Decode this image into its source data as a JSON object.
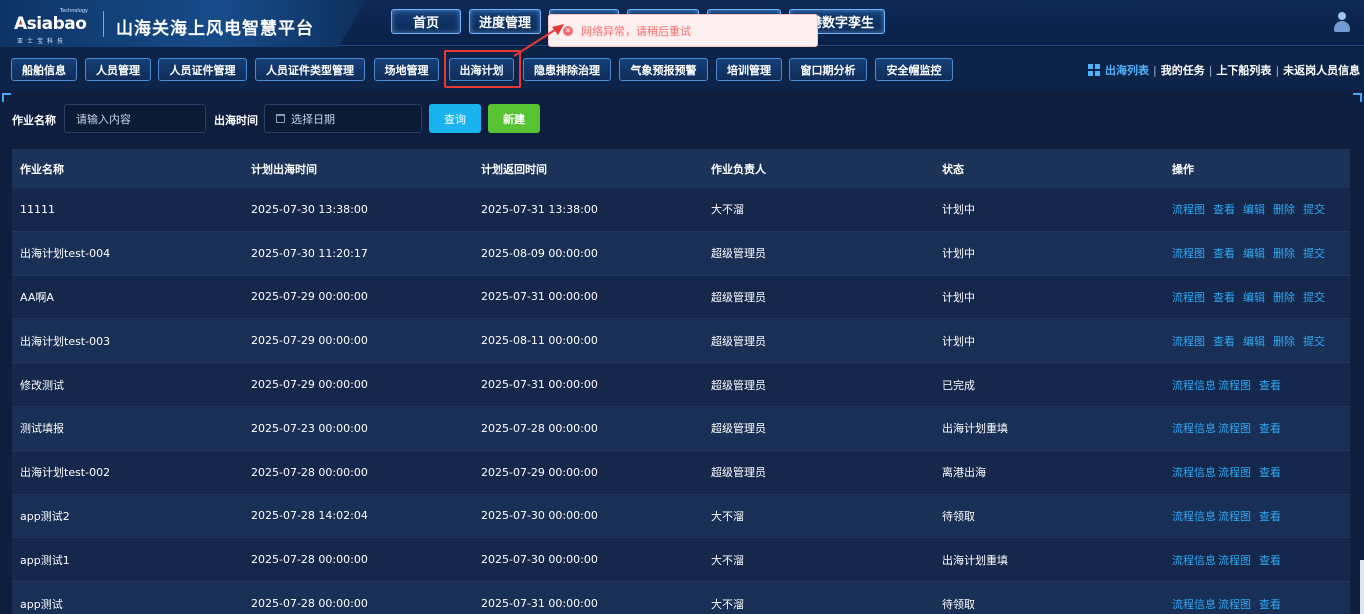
{
  "brand": {
    "logo_text": "Asiabao",
    "logo_tagline": "Technology",
    "logo_sub": "亚士宝科技",
    "app_title": "山海关海上风电智慧平台"
  },
  "top_nav": [
    {
      "label": "首页"
    },
    {
      "label": "进度管理"
    },
    {
      "label": ""
    },
    {
      "label": ""
    },
    {
      "label": ""
    },
    {
      "label": "港数字孪生"
    }
  ],
  "toast": {
    "message": "网络异常，请稍后重试",
    "color": "#f56c6c"
  },
  "sub_tabs": [
    {
      "label": "船舶信息"
    },
    {
      "label": "人员管理"
    },
    {
      "label": "人员证件管理"
    },
    {
      "label": "人员证件类型管理"
    },
    {
      "label": "场地管理"
    },
    {
      "label": "出海计划",
      "active": true
    },
    {
      "label": "隐患排除治理"
    },
    {
      "label": "气象预报预警"
    },
    {
      "label": "培训管理"
    },
    {
      "label": "窗口期分析"
    },
    {
      "label": "安全帽监控"
    }
  ],
  "right_links": [
    {
      "label": "出海列表",
      "active": true
    },
    {
      "label": "我的任务"
    },
    {
      "label": "上下船列表"
    },
    {
      "label": "未返岗人员信息"
    }
  ],
  "filters": {
    "job_name_label": "作业名称",
    "job_name_placeholder": "请输入内容",
    "date_label": "出海时间",
    "date_placeholder": "选择日期",
    "query_label": "查询",
    "create_label": "新建"
  },
  "table": {
    "headers": [
      "作业名称",
      "计划出海时间",
      "计划返回时间",
      "作业负责人",
      "状态",
      "操作"
    ],
    "rows": [
      {
        "name": "11111",
        "depart": "2025-07-30 13:38:00",
        "return": "2025-07-31 13:38:00",
        "owner": "大不溜",
        "status": "计划中",
        "actions": [
          "流程图",
          "查看",
          "编辑",
          "删除",
          "提交"
        ]
      },
      {
        "name": "出海计划test-004",
        "depart": "2025-07-30 11:20:17",
        "return": "2025-08-09 00:00:00",
        "owner": "超级管理员",
        "status": "计划中",
        "actions": [
          "流程图",
          "查看",
          "编辑",
          "删除",
          "提交"
        ]
      },
      {
        "name": "AA啊A",
        "depart": "2025-07-29 00:00:00",
        "return": "2025-07-31 00:00:00",
        "owner": "超级管理员",
        "status": "计划中",
        "actions": [
          "流程图",
          "查看",
          "编辑",
          "删除",
          "提交"
        ]
      },
      {
        "name": "出海计划test-003",
        "depart": "2025-07-29 00:00:00",
        "return": "2025-08-11 00:00:00",
        "owner": "超级管理员",
        "status": "计划中",
        "actions": [
          "流程图",
          "查看",
          "编辑",
          "删除",
          "提交"
        ]
      },
      {
        "name": "修改测试",
        "depart": "2025-07-29 00:00:00",
        "return": "2025-07-31 00:00:00",
        "owner": "超级管理员",
        "status": "已完成",
        "actions": [
          "流程信息",
          "流程图",
          "查看"
        ]
      },
      {
        "name": "测试填报",
        "depart": "2025-07-23 00:00:00",
        "return": "2025-07-28 00:00:00",
        "owner": "超级管理员",
        "status": "出海计划重填",
        "actions": [
          "流程信息",
          "流程图",
          "查看"
        ]
      },
      {
        "name": "出海计划test-002",
        "depart": "2025-07-28 00:00:00",
        "return": "2025-07-29 00:00:00",
        "owner": "超级管理员",
        "status": "离港出海",
        "actions": [
          "流程信息",
          "流程图",
          "查看"
        ]
      },
      {
        "name": "app测试2",
        "depart": "2025-07-28 14:02:04",
        "return": "2025-07-30 00:00:00",
        "owner": "大不溜",
        "status": "待领取",
        "actions": [
          "流程信息",
          "流程图",
          "查看"
        ]
      },
      {
        "name": "app测试1",
        "depart": "2025-07-28 00:00:00",
        "return": "2025-07-30 00:00:00",
        "owner": "大不溜",
        "status": "出海计划重填",
        "actions": [
          "流程信息",
          "流程图",
          "查看"
        ]
      },
      {
        "name": "app测试",
        "depart": "2025-07-28 00:00:00",
        "return": "2025-07-31 00:00:00",
        "owner": "大不溜",
        "status": "待领取",
        "actions": [
          "流程信息",
          "流程图",
          "查看"
        ]
      }
    ]
  },
  "colors": {
    "accent": "#2fa8f5",
    "query_button": "#19b4f0",
    "create_button": "#58c332",
    "highlight_box": "#e53935"
  }
}
